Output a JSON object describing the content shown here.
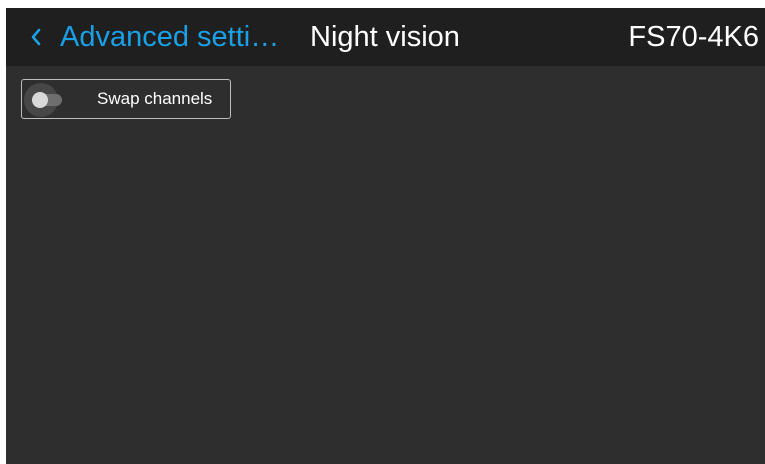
{
  "header": {
    "back_label": "Advanced setti…",
    "back_icon": "chevron-left-icon",
    "title": "Night vision",
    "device": "FS70-4K6"
  },
  "settings": {
    "swap_channels": {
      "label": "Swap channels",
      "state": "off"
    }
  },
  "colors": {
    "accent": "#1aa0e6",
    "header_bg": "#1f1f1f",
    "content_bg": "#2e2e2e"
  }
}
